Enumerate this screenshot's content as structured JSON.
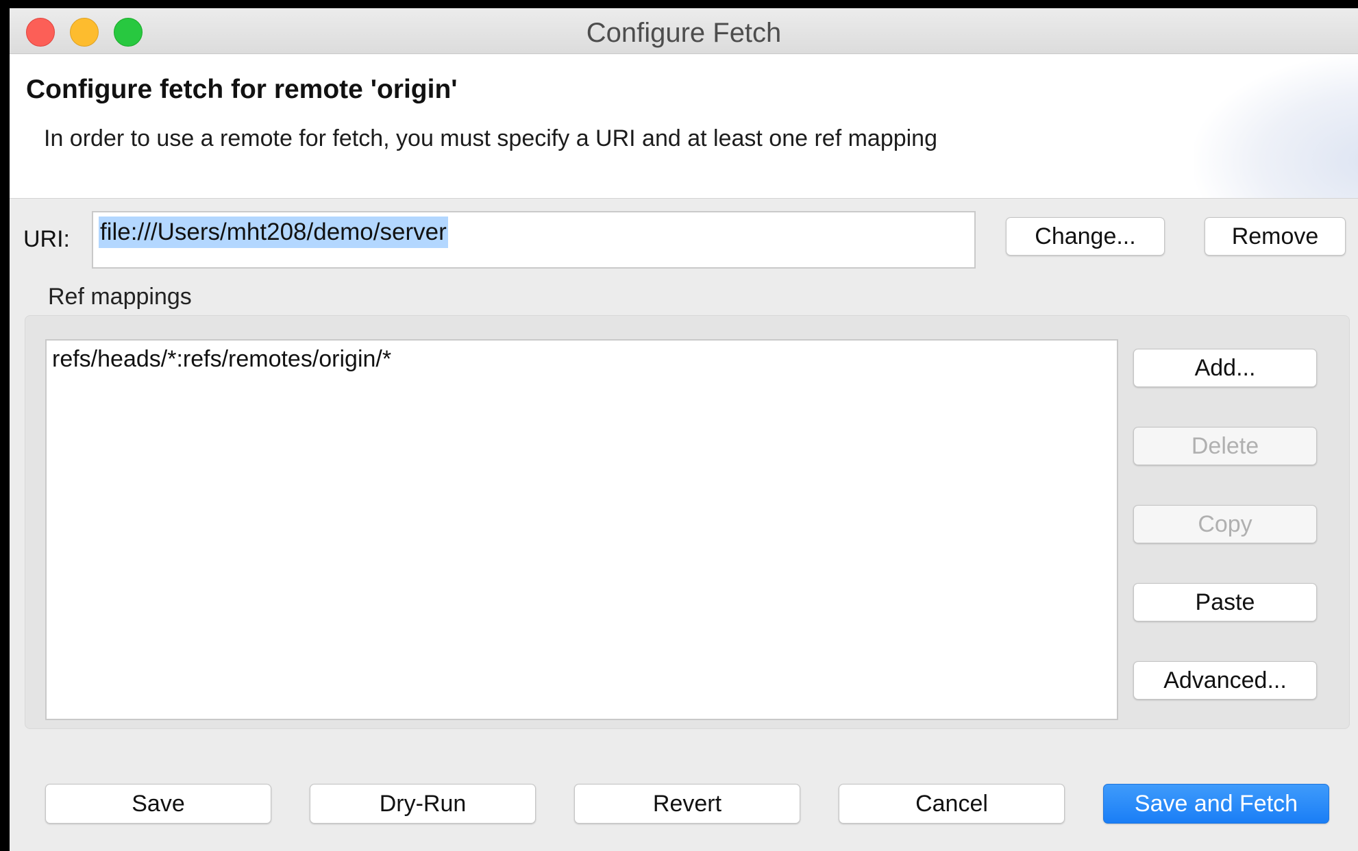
{
  "window": {
    "title": "Configure Fetch"
  },
  "banner": {
    "title": "Configure fetch for remote 'origin'",
    "description": "In order to use a remote for fetch, you must specify a URI and at least one ref mapping"
  },
  "uri": {
    "label": "URI:",
    "value": "file:///Users/mht208/demo/server",
    "change_label": "Change...",
    "remove_label": "Remove"
  },
  "ref_mappings": {
    "legend": "Ref mappings",
    "items": [
      "refs/heads/*:refs/remotes/origin/*"
    ],
    "add_label": "Add...",
    "delete_label": "Delete",
    "copy_label": "Copy",
    "paste_label": "Paste",
    "advanced_label": "Advanced...",
    "delete_enabled": false,
    "copy_enabled": false
  },
  "footer": {
    "save_label": "Save",
    "dry_run_label": "Dry-Run",
    "revert_label": "Revert",
    "cancel_label": "Cancel",
    "save_and_fetch_label": "Save and Fetch"
  },
  "colors": {
    "primary_button": "#1a7ef6",
    "selection_highlight": "#b3d7ff",
    "close_light": "#fc5f57",
    "minimize_light": "#fdbc2e",
    "zoom_light": "#28c840"
  }
}
